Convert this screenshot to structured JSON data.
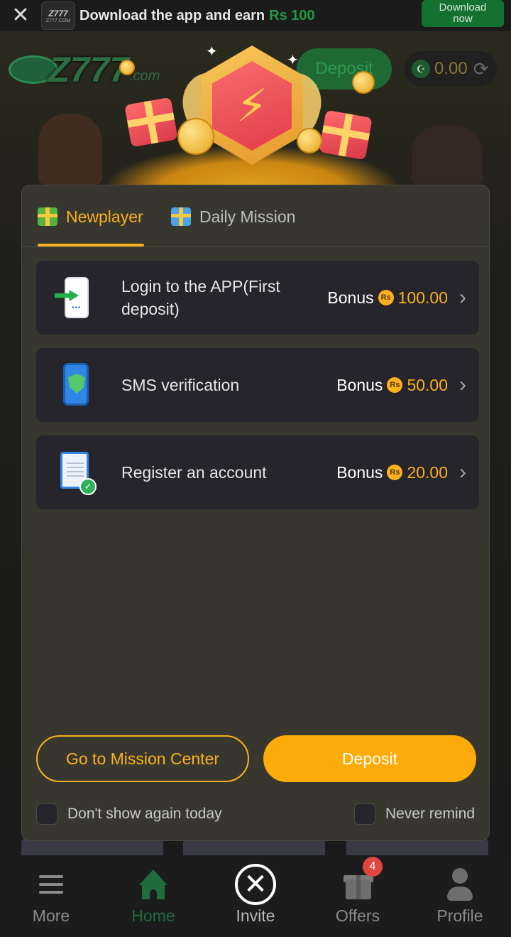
{
  "banner": {
    "close_icon": "close-icon",
    "app_logo_text": "Z777",
    "app_logo_sub": "Z777.COM",
    "text": "Download the app and earn",
    "amount": "Rs 100",
    "button_line1": "Download",
    "button_line2": "now"
  },
  "header": {
    "brand": "Z777",
    "brand_suffix": ".com",
    "deposit_label": "Deposit",
    "balance": "0.00"
  },
  "modal": {
    "tabs": [
      {
        "label": "Newplayer",
        "active": true
      },
      {
        "label": "Daily Mission",
        "active": false
      }
    ],
    "tasks": [
      {
        "label": "Login to the APP(First deposit)",
        "bonus_label": "Bonus",
        "currency": "Rs",
        "bonus": "100.00",
        "icon": "app-login-icon"
      },
      {
        "label": "SMS verification",
        "bonus_label": "Bonus",
        "currency": "Rs",
        "bonus": "50.00",
        "icon": "sms-shield-icon"
      },
      {
        "label": "Register an account",
        "bonus_label": "Bonus",
        "currency": "Rs",
        "bonus": "20.00",
        "icon": "register-clipboard-icon"
      }
    ],
    "mission_button": "Go to Mission Center",
    "deposit_button": "Deposit",
    "dont_show": "Don't show again today",
    "never_remind": "Never remind"
  },
  "nav": {
    "items": [
      {
        "label": "More",
        "icon": "menu-icon"
      },
      {
        "label": "Home",
        "icon": "home-icon",
        "active": true
      },
      {
        "label": "Invite",
        "icon": "invite-icon"
      },
      {
        "label": "Offers",
        "icon": "gift-icon",
        "badge": "4"
      },
      {
        "label": "Profile",
        "icon": "profile-icon"
      }
    ]
  },
  "colors": {
    "accent": "#fbb020",
    "brand_green": "#1f6d3d",
    "modal_bg": "#38372f",
    "card_bg": "#25252b"
  }
}
